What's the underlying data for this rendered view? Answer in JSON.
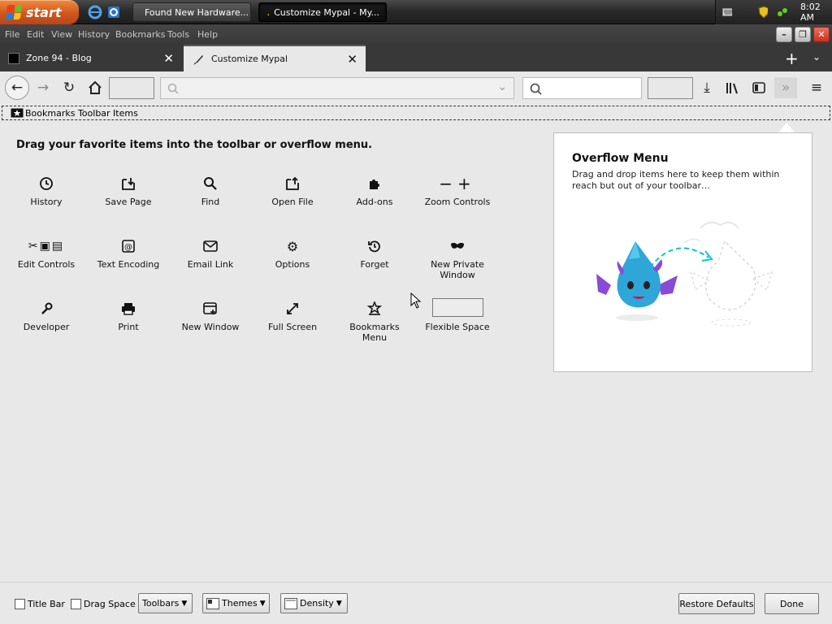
{
  "taskbar": {
    "start_label": "start",
    "tasks": [
      {
        "label": "Found New Hardware..."
      },
      {
        "label": "Customize Mypal - My..."
      }
    ],
    "clock": "8:02 AM",
    "colors": {
      "start": "#d2561c",
      "taskbar": "#2a2a2a"
    }
  },
  "menubar": {
    "items": [
      "File",
      "Edit",
      "View",
      "History",
      "Bookmarks",
      "Tools",
      "Help"
    ]
  },
  "tabs": [
    {
      "label": "Zone 94 - Blog",
      "active": false
    },
    {
      "label": "Customize Mypal",
      "active": true
    }
  ],
  "bookmarks_toolbar": {
    "label": "Bookmarks Toolbar Items"
  },
  "customize": {
    "heading": "Drag your favorite items into the toolbar or overflow menu.",
    "items": [
      {
        "label": "History",
        "icon": "clock-icon"
      },
      {
        "label": "Save Page",
        "icon": "save-page-icon"
      },
      {
        "label": "Find",
        "icon": "search-icon"
      },
      {
        "label": "Open File",
        "icon": "open-file-icon"
      },
      {
        "label": "Add-ons",
        "icon": "puzzle-icon"
      },
      {
        "label": "Zoom Controls",
        "icon": "zoom-icon"
      },
      {
        "label": "Edit Controls",
        "icon": "edit-controls-icon"
      },
      {
        "label": "Text Encoding",
        "icon": "text-encoding-icon"
      },
      {
        "label": "Email Link",
        "icon": "envelope-icon"
      },
      {
        "label": "Options",
        "icon": "gear-icon"
      },
      {
        "label": "Forget",
        "icon": "forget-icon"
      },
      {
        "label": "New Private Window",
        "icon": "mask-icon"
      },
      {
        "label": "Developer",
        "icon": "wrench-icon"
      },
      {
        "label": "Print",
        "icon": "printer-icon"
      },
      {
        "label": "New Window",
        "icon": "new-window-icon"
      },
      {
        "label": "Full Screen",
        "icon": "fullscreen-icon"
      },
      {
        "label": "Bookmarks Menu",
        "icon": "bookmarks-menu-icon"
      },
      {
        "label": "Flexible Space",
        "icon": "flexible-space-icon"
      }
    ]
  },
  "overflow": {
    "title": "Overflow Menu",
    "description": "Drag and drop items here to keep them within reach but out of your toolbar…"
  },
  "bottom": {
    "title_bar": "Title Bar",
    "drag_space": "Drag Space",
    "toolbars": "Toolbars",
    "themes": "Themes",
    "density": "Density",
    "restore": "Restore Defaults",
    "done": "Done"
  }
}
